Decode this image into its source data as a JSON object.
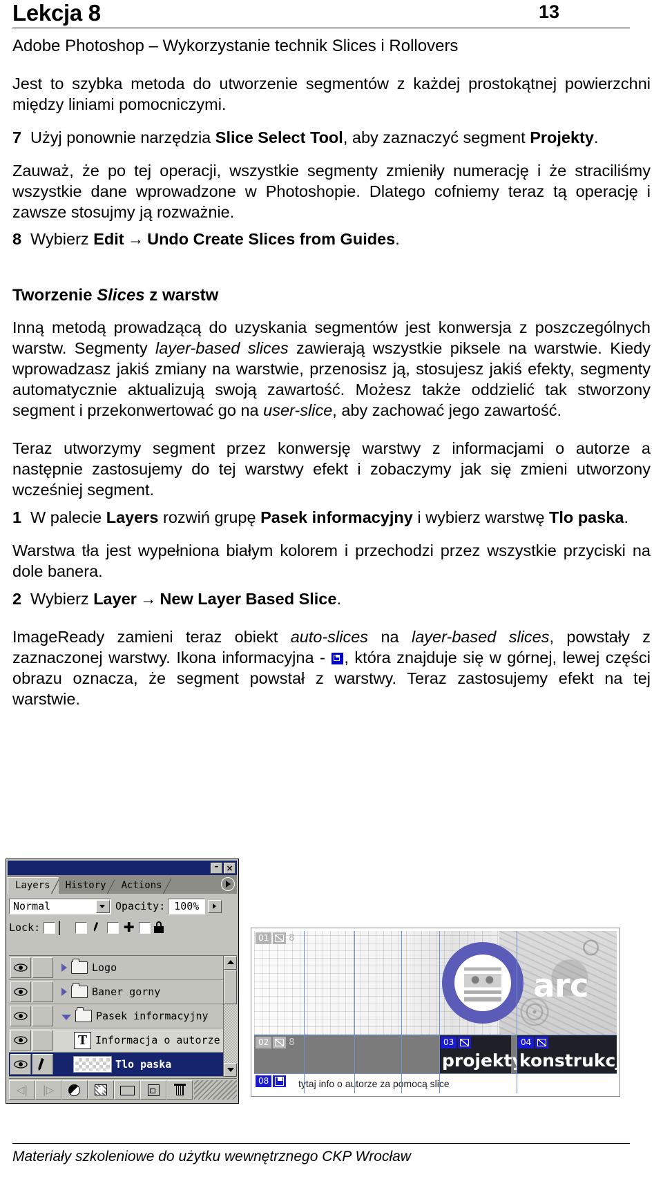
{
  "header": {
    "title": "Lekcja 8",
    "page_number": "13",
    "subtitle": "Adobe Photoshop – Wykorzystanie technik Slices i Rollovers"
  },
  "intro": {
    "paragraph": "Jest to szybka metoda do utworzenie segmentów z każdej prostokątnej powierzchni między liniami pomocniczymi."
  },
  "step7": {
    "number": "7",
    "text_before": "Użyj ponownie narzędzia ",
    "bold1": "Slice Select Tool",
    "text_mid": ", aby zaznaczyć segment ",
    "bold2": "Projekty",
    "text_after": "."
  },
  "note1": {
    "paragraph": "Zauważ, że po tej operacji, wszystkie segmenty zmieniły numerację i że straciliśmy wszystkie dane wprowadzone w Photoshopie. Dlatego cofniemy teraz tą operację i zawsze stosujmy ją rozważnie."
  },
  "step8": {
    "number": "8",
    "text_before": "Wybierz ",
    "bold1": "Edit",
    "arrow": "→",
    "bold2": "Undo Create Slices from Guides",
    "text_after": "."
  },
  "section": {
    "heading_part1": "Tworzenie ",
    "heading_italic": "Slices",
    "heading_part2": " z warstw"
  },
  "body1": {
    "t1": "Inną metodą prowadzącą do uzyskania segmentów jest konwersja z poszczególnych warstw. Segmenty ",
    "i1": "layer-based slices",
    "t2": " zawierają wszystkie piksele na warstwie. Kiedy wprowadzasz jakiś zmiany na warstwie, przenosisz ją, stosujesz jakiś efekty, segmenty automatycznie aktualizują swoją zawartość. Możesz także oddzielić tak stworzony segment i przekonwertować go na ",
    "i2": "user-slice",
    "t3": ", aby zachować jego zawartość."
  },
  "body2": {
    "paragraph": "Teraz utworzymy segment przez konwersję warstwy z informacjami o autorze a następnie zastosujemy do tej warstwy efekt i zobaczymy jak się zmieni utworzony wcześniej segment."
  },
  "step1": {
    "number": "1",
    "t1": "W palecie ",
    "b1": "Layers",
    "t2": " rozwiń grupę ",
    "b2": "Pasek informacyjny",
    "t3": " i wybierz warstwę ",
    "b3": "Tlo paska",
    "t4": "."
  },
  "body3": {
    "paragraph": "Warstwa tła jest wypełniona białym kolorem i przechodzi przez wszystkie przyciski na dole banera."
  },
  "step2": {
    "number": "2",
    "t1": "Wybierz ",
    "b1": "Layer",
    "arrow": "→",
    "b2": "New Layer Based Slice",
    "t2": "."
  },
  "body4": {
    "t1": "ImageReady zamieni teraz obiekt ",
    "i1": "auto-slices",
    "t2": " na ",
    "i2": "layer-based slices",
    "t3": ", powstały z zaznaczonej warstwy. Ikona informacyjna - ",
    "t4": ", która znajduje się w górnej, lewej części obrazu oznacza, że segment powstał z warstwy. Teraz zastosujemy efekt na tej warstwie."
  },
  "layers_palette": {
    "titlebar": {
      "minimize": "–",
      "close": "×"
    },
    "tabs": [
      {
        "label": "Layers",
        "active": true
      },
      {
        "label": "History",
        "active": false
      },
      {
        "label": "Actions",
        "active": false
      }
    ],
    "blend_mode": "Normal",
    "opacity_label": "Opacity:",
    "opacity_value": "100%",
    "lock_label": "Lock:",
    "lock_icons": [
      "transparency-checker-icon",
      "paintbrush-icon",
      "move-icon",
      "lock-all-icon"
    ],
    "rows": [
      {
        "name": "Logo",
        "type": "group",
        "expanded": false,
        "selected": false,
        "indent": false,
        "eye": true,
        "edit_icon": false
      },
      {
        "name": "Baner gorny",
        "type": "group",
        "expanded": false,
        "selected": false,
        "indent": false,
        "eye": true,
        "edit_icon": false
      },
      {
        "name": "Pasek informacyjny",
        "type": "group",
        "expanded": true,
        "selected": false,
        "indent": false,
        "eye": true,
        "edit_icon": false
      },
      {
        "name": "Informacja o autorze",
        "type": "text",
        "expanded": false,
        "selected": false,
        "indent": true,
        "eye": true,
        "edit_icon": false
      },
      {
        "name": "Tlo paska",
        "type": "pixel",
        "expanded": false,
        "selected": true,
        "indent": true,
        "eye": true,
        "edit_icon": true
      }
    ],
    "bottom_buttons": [
      "prev-frame-button",
      "next-frame-button",
      "layer-style-button",
      "layer-mask-button",
      "new-group-button",
      "new-layer-button",
      "delete-layer-button"
    ]
  },
  "banner": {
    "logo_word": "arc",
    "slices": [
      {
        "id": "01",
        "badge": "grey",
        "icon": "image-icon",
        "chain": "8",
        "label": ""
      },
      {
        "id": "02",
        "badge": "grey",
        "icon": "image-icon",
        "chain": "8",
        "label": ""
      },
      {
        "id": "03",
        "badge": "blue",
        "icon": "image-icon",
        "chain": "",
        "label": "projekty"
      },
      {
        "id": "04",
        "badge": "blue",
        "icon": "image-icon",
        "chain": "",
        "label": "konstrukcje"
      },
      {
        "id": "08",
        "badge": "blue",
        "icon": "layer-based-slice-icon",
        "chain": "",
        "label": ""
      }
    ],
    "info_text": "tytaj info o autorze za pomocą slice",
    "guide_color": "#6f8fd0",
    "accent_color": "#5b5bb8"
  },
  "footer": {
    "text": "Materiały szkoleniowe do użytku wewnętrznego CKP Wrocław"
  }
}
